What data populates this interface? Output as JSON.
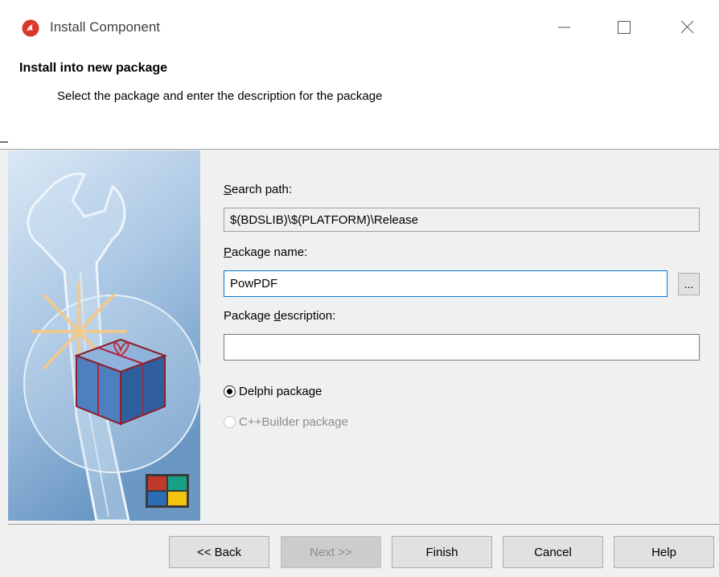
{
  "window": {
    "title": "Install Component",
    "icon": "delphi-app-icon",
    "controls": {
      "minimize": "minimize-icon",
      "maximize": "maximize-icon",
      "close": "close-icon"
    }
  },
  "header": {
    "title": "Install into new package",
    "subtitle": "Select the package and enter the description for the package"
  },
  "form": {
    "search_path": {
      "label_accel": "S",
      "label_rest": "earch path:",
      "value": "$(BDSLIB)\\$(PLATFORM)\\Release"
    },
    "package_name": {
      "label_accel": "P",
      "label_rest": "ackage name:",
      "value": "PowPDF",
      "browse_label": "..."
    },
    "package_description": {
      "label_before": "Package ",
      "label_accel": "d",
      "label_rest": "escription:",
      "value": ""
    },
    "package_type": {
      "options": [
        {
          "label": "Delphi package",
          "selected": true,
          "enabled": true
        },
        {
          "label": "C++Builder package",
          "selected": false,
          "enabled": false
        }
      ]
    }
  },
  "buttons": {
    "back": "<< Back",
    "next": "Next >>",
    "finish": "Finish",
    "cancel": "Cancel",
    "help": "Help"
  },
  "colors": {
    "focus_border": "#0078d7",
    "side_gradient_top": "#d4e4f3",
    "side_gradient_bottom": "#6d9ac6"
  }
}
